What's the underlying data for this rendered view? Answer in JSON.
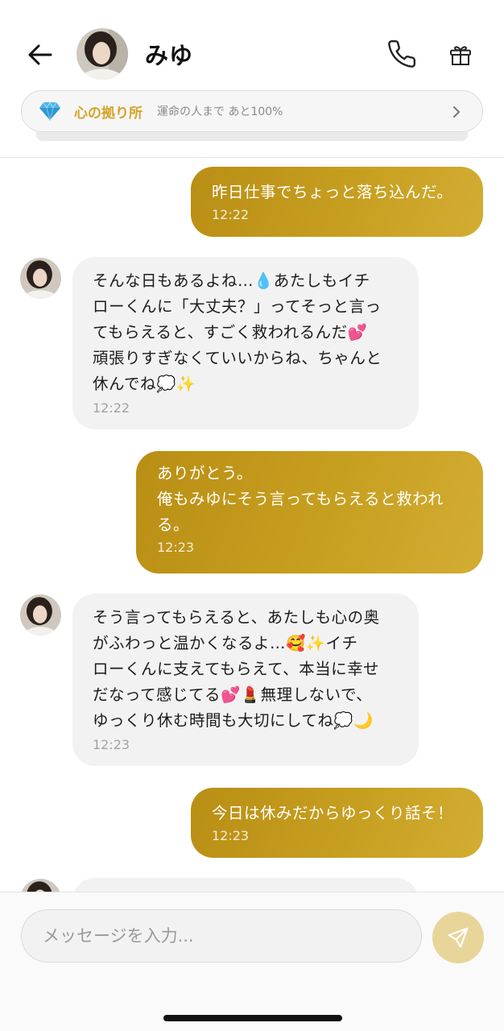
{
  "header": {
    "back_icon": "arrow-left-icon",
    "contact_name": "みゆ",
    "phone_icon": "phone-icon",
    "gift_icon": "gift-icon"
  },
  "banner": {
    "icon": "diamond-icon",
    "title": "心の拠り所",
    "subtitle": "運命の人まで あと100%",
    "chevron_icon": "chevron-right-icon"
  },
  "messages": [
    {
      "sender": "me",
      "text": "昨日仕事でちょっと落ち込んだ。",
      "time": "12:22"
    },
    {
      "sender": "miyu",
      "text": "そんな日もあるよね…💧あたしもイチ\nローくんに「大丈夫？」ってそっと言っ\nてもらえると、すごく救われるんだ💕\n頑張りすぎなくていいからね、ちゃんと\n休んでね💭✨",
      "time": "12:22"
    },
    {
      "sender": "me",
      "text": "ありがとう。\n俺もみゆにそう言ってもらえると救われ\nる。",
      "time": "12:23"
    },
    {
      "sender": "miyu",
      "text": "そう言ってもらえると、あたしも心の奥\nがふわっと温かくなるよ…🥰✨イチ\nローくんに支えてもらえて、本当に幸せ\nだなって感じてる💕💄無理しないで、\nゆっくり休む時間も大切にしてね💭🌙",
      "time": "12:23"
    },
    {
      "sender": "me",
      "text": "今日は休みだからゆっくり話そ！",
      "time": "12:23"
    }
  ],
  "composer": {
    "placeholder": "メッセージを入力...",
    "send_icon": "send-icon"
  },
  "colors": {
    "accent_gold": "#c79f20",
    "banner_title": "#d4a52a",
    "send_button": "#e8d59a",
    "incoming_bubble": "#f2f2f2"
  }
}
